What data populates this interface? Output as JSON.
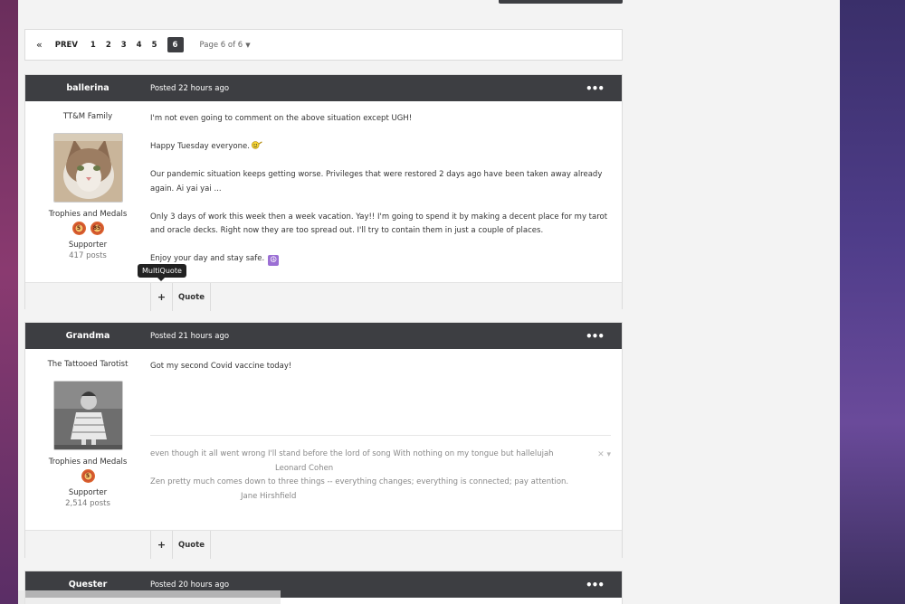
{
  "pagination": {
    "first_icon": "«",
    "prev_label": "PREV",
    "pages": [
      "1",
      "2",
      "3",
      "4",
      "5"
    ],
    "current_page": "6",
    "page_of": "Page 6 of 6",
    "caret_icon": "chevron-down-icon"
  },
  "posts": [
    {
      "author": "ballerina",
      "date": "Posted 22 hours ago",
      "title": "TT&M Family",
      "trophies_label": "Trophies and Medals",
      "group": "Supporter",
      "post_count": "417 posts",
      "paragraphs": [
        "I'm not even going to comment on the above situation except UGH!",
        "Happy Tuesday everyone.",
        "Our pandemic situation keeps getting worse.  Privileges that were restored 2 days ago have been taken away already again.  Ai yai yai ...",
        "Only 3 days of work this week then a week vacation.  Yay!!  I'm going to spend it by making a decent place for my tarot and oracle decks.  Right now they are too spread out.  I'll try to contain them in just a couple of places.",
        "Enjoy your day and stay safe."
      ],
      "more_icon": "•••"
    },
    {
      "author": "Grandma",
      "date": "Posted 21 hours ago",
      "title": "The Tattooed Tarotist",
      "trophies_label": "Trophies and Medals",
      "group": "Supporter",
      "post_count": "2,514 posts",
      "paragraphs": [
        "Got my second Covid vaccine today!"
      ],
      "signature": [
        "even though it all went wrong I'll stand before the lord of song With nothing on my tongue but hallelujah",
        "Leonard Cohen",
        "Zen pretty much comes down to three things -- everything changes; everything is connected; pay attention.",
        "Jane Hirshfield"
      ],
      "more_icon": "•••"
    },
    {
      "author": "Quester",
      "date": "Posted 20 hours ago",
      "more_icon": "•••"
    }
  ],
  "footer": {
    "multiquote_plus": "+",
    "quote_label": "Quote",
    "multiquote_tooltip": "MultiQuote"
  },
  "sig_close": "✕ ▾"
}
